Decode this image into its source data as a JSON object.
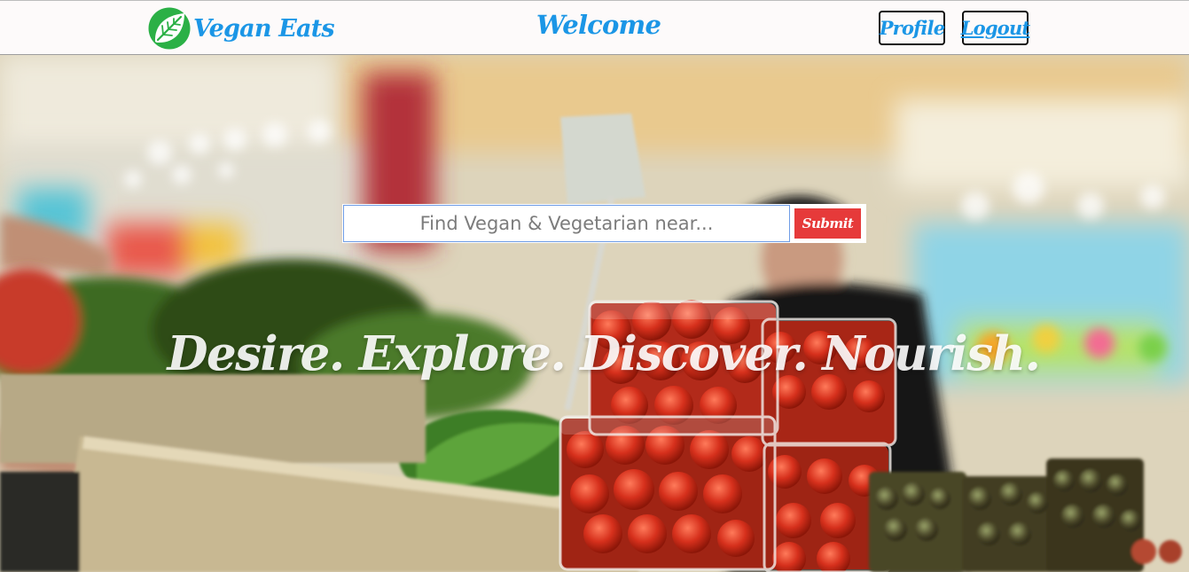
{
  "navbar": {
    "brand_name": "Vegan Eats",
    "title": "Welcome",
    "profile_label": "Profile",
    "logout_label": "Logout"
  },
  "search": {
    "placeholder": "Find Vegan & Vegetarian near...",
    "value": "",
    "submit_label": "Submit"
  },
  "hero": {
    "tagline": "Desire. Explore. Discover. Nourish."
  },
  "icons": {
    "brand_logo": "leaf-icon"
  },
  "colors": {
    "brand_blue": "#1b96e6",
    "logo_green": "#2bb046",
    "submit_red": "#e63a3a",
    "navbar_bg": "#fdfafa"
  }
}
